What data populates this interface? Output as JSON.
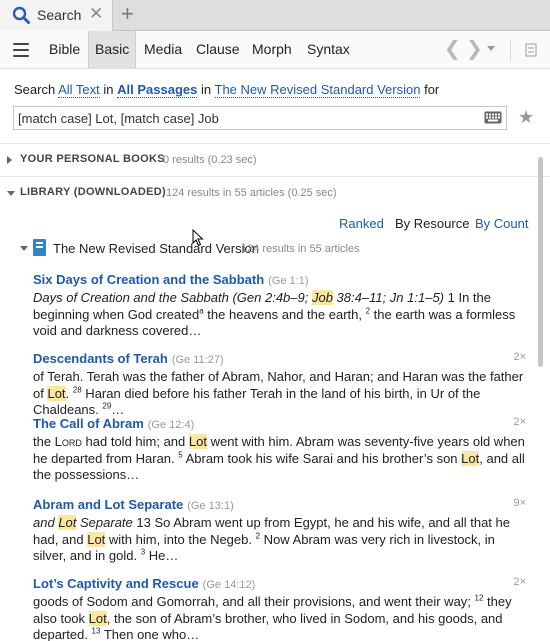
{
  "tab": {
    "label": "Search",
    "close": "✕",
    "add": "+"
  },
  "menu": {
    "items": [
      {
        "label": "Bible",
        "active": false
      },
      {
        "label": "Basic",
        "active": true
      },
      {
        "label": "Media",
        "active": false
      },
      {
        "label": "Clause",
        "active": false
      },
      {
        "label": "Morph",
        "active": false
      },
      {
        "label": "Syntax",
        "active": false
      }
    ],
    "back": "❮",
    "forward": "❯"
  },
  "search": {
    "prefix": "Search",
    "scope_text": "All Text",
    "in1": "in",
    "passages": "All Passages",
    "in2": "in",
    "version": "The New Revised Standard Version",
    "for": "for",
    "query": "[match case] Lot, [match case] Job"
  },
  "personal": {
    "title": "YOUR PERSONAL BOOKS",
    "count": "0 results (0.23 sec)"
  },
  "library": {
    "title": "LIBRARY (DOWNLOADED)",
    "count": "124 results in 55 articles (0.25 sec)"
  },
  "sort": {
    "ranked": "Ranked",
    "by_resource": "By Resource",
    "by_count": "By Count"
  },
  "resource": {
    "title": "The New Revised Standard Version",
    "count": "124 results in 55 articles"
  },
  "results": [
    {
      "title": "Six Days of Creation and the Sabbath",
      "ref": "(Ge 1:1)",
      "hits": "",
      "segments": [
        {
          "t": "Days of Creation and the Sabbath (Gen 2:4b–9; ",
          "i": true
        },
        {
          "t": "Job",
          "i": true,
          "hl": true
        },
        {
          "t": " 38:4–11; Jn 1:1–5)",
          "i": true
        },
        {
          "t": " 1 In the beginning when God created"
        },
        {
          "t": "a",
          "sup": true
        },
        {
          "t": " the heavens and the earth, "
        },
        {
          "t": "2",
          "sup": true
        },
        {
          "t": " the earth was a formless void and darkness covered…"
        }
      ]
    },
    {
      "title": "Descendants of Terah",
      "ref": "(Ge 11:27)",
      "hits": "2×",
      "segments": [
        {
          "t": "of Terah. Terah was the father of Abram, Nahor, and Haran; and Haran was the father of "
        },
        {
          "t": "Lot",
          "hl": true
        },
        {
          "t": ". "
        },
        {
          "t": "28",
          "sup": true
        },
        {
          "t": " Haran died before his father Terah in the land of his birth, in Ur of the Chaldeans. "
        },
        {
          "t": "29",
          "sup": true
        },
        {
          "t": "…"
        }
      ]
    },
    {
      "title": "The Call of Abram",
      "ref": "(Ge 12:4)",
      "hits": "2×",
      "segments": [
        {
          "t": "the L"
        },
        {
          "t": "ord",
          "sc": true
        },
        {
          "t": " had told him; and "
        },
        {
          "t": "Lot",
          "hl": true
        },
        {
          "t": " went with him. Abram was seventy-five years old when he departed from Haran. "
        },
        {
          "t": "5",
          "sup": true
        },
        {
          "t": " Abram took his wife Sarai and his brother’s son "
        },
        {
          "t": "Lot",
          "hl": true
        },
        {
          "t": ", and all the possessions…"
        }
      ]
    },
    {
      "title": "Abram and Lot Separate",
      "ref": "(Ge 13:1)",
      "hits": "9×",
      "segments": [
        {
          "t": "and ",
          "i": true
        },
        {
          "t": "Lot",
          "i": true,
          "hl": true
        },
        {
          "t": " Separate",
          "i": true
        },
        {
          "t": " 13 So Abram went up from Egypt, he and his wife, and all that he had, and "
        },
        {
          "t": "Lot",
          "hl": true
        },
        {
          "t": " with him, into the Negeb. "
        },
        {
          "t": "2",
          "sup": true
        },
        {
          "t": " Now Abram was very rich in livestock, in silver, and in gold. "
        },
        {
          "t": "3",
          "sup": true
        },
        {
          "t": " He…"
        }
      ]
    },
    {
      "title": "Lot’s Captivity and Rescue",
      "ref": "(Ge 14:12)",
      "hits": "2×",
      "segments": [
        {
          "t": "goods of Sodom and Gomorrah, and all their provisions, and went their way; "
        },
        {
          "t": "12",
          "sup": true
        },
        {
          "t": " they also took "
        },
        {
          "t": "Lot",
          "hl": true
        },
        {
          "t": ", the son of Abram’s brother, who lived in Sodom, and his goods, and departed. "
        },
        {
          "t": "13",
          "sup": true
        },
        {
          "t": " Then one who…"
        }
      ]
    }
  ]
}
